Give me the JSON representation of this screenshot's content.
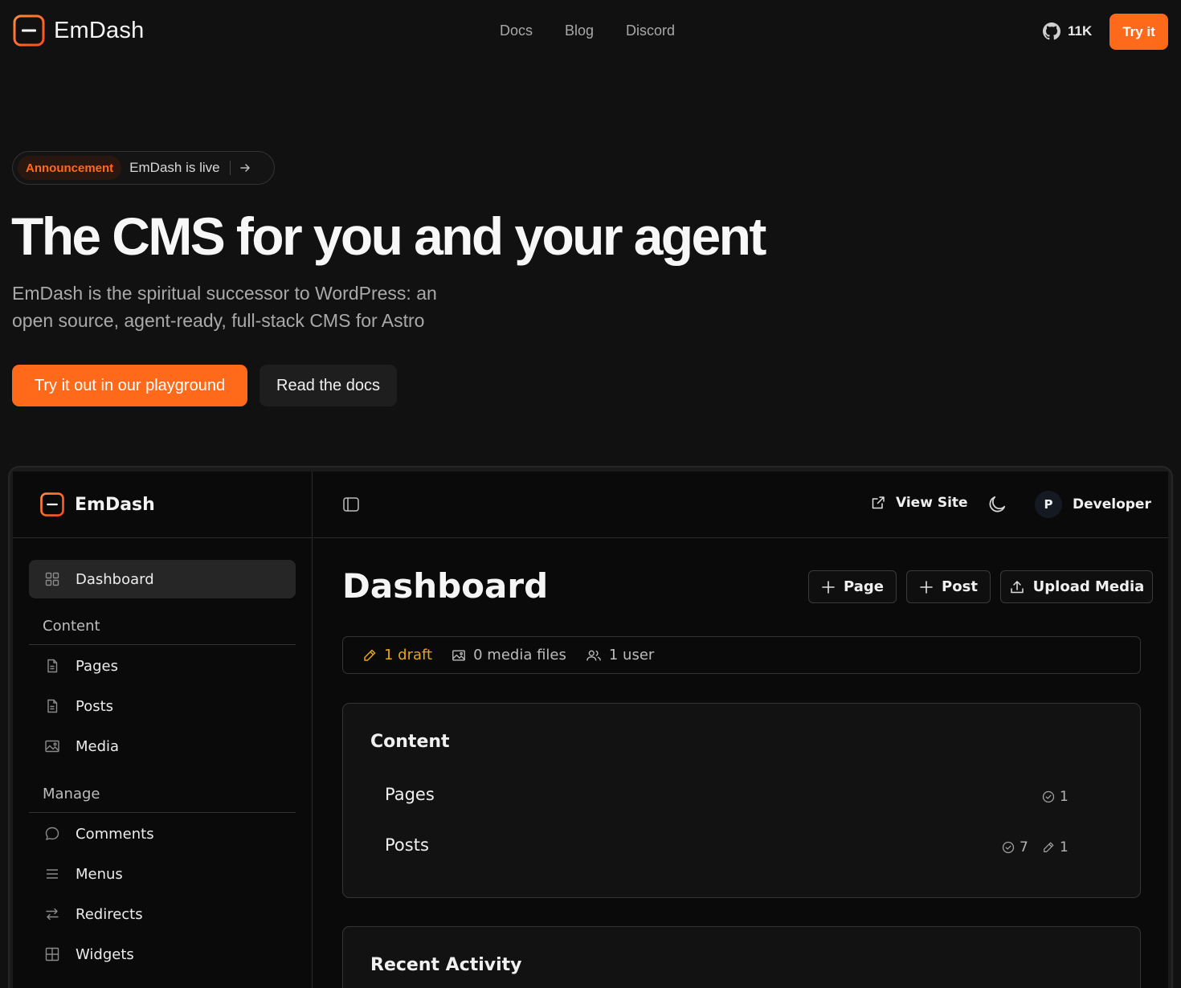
{
  "nav": {
    "brand": "EmDash",
    "links": [
      "Docs",
      "Blog",
      "Discord"
    ],
    "github_stars": "11K",
    "cta": "Try it"
  },
  "hero": {
    "announcement_tag": "Announcement",
    "announcement_text": "EmDash is live",
    "title": "The CMS for you and your agent",
    "subtitle": "EmDash is the spiritual successor to WordPress: an open source, agent-ready, full-stack CMS for Astro",
    "primary_button": "Try it out in our playground",
    "secondary_button": "Read the docs"
  },
  "admin": {
    "brand": "EmDash",
    "topbar": {
      "view_site": "View Site",
      "user_initial": "P",
      "user_name": "Developer"
    },
    "sidebar": {
      "active": {
        "label": "Dashboard",
        "icon": "grid-icon"
      },
      "content_heading": "Content",
      "content_items": [
        {
          "label": "Pages",
          "icon": "file-icon"
        },
        {
          "label": "Posts",
          "icon": "file-icon"
        },
        {
          "label": "Media",
          "icon": "image-icon"
        }
      ],
      "manage_heading": "Manage",
      "manage_items": [
        {
          "label": "Comments",
          "icon": "comment-icon"
        },
        {
          "label": "Menus",
          "icon": "menu-icon"
        },
        {
          "label": "Redirects",
          "icon": "redirect-icon"
        },
        {
          "label": "Widgets",
          "icon": "widgets-icon"
        }
      ]
    },
    "page_title": "Dashboard",
    "actions": {
      "page": "Page",
      "post": "Post",
      "upload": "Upload Media"
    },
    "stats": {
      "drafts": "1 draft",
      "media": "0 media files",
      "users": "1 user"
    },
    "content_card": {
      "title": "Content",
      "rows": [
        {
          "label": "Pages",
          "published": "1"
        },
        {
          "label": "Posts",
          "published": "7",
          "drafts": "1"
        }
      ]
    },
    "activity_card": {
      "title": "Recent Activity"
    },
    "colors": {
      "accent": "#ff6a1a",
      "draft": "#e6a516",
      "background": "#111111"
    }
  }
}
